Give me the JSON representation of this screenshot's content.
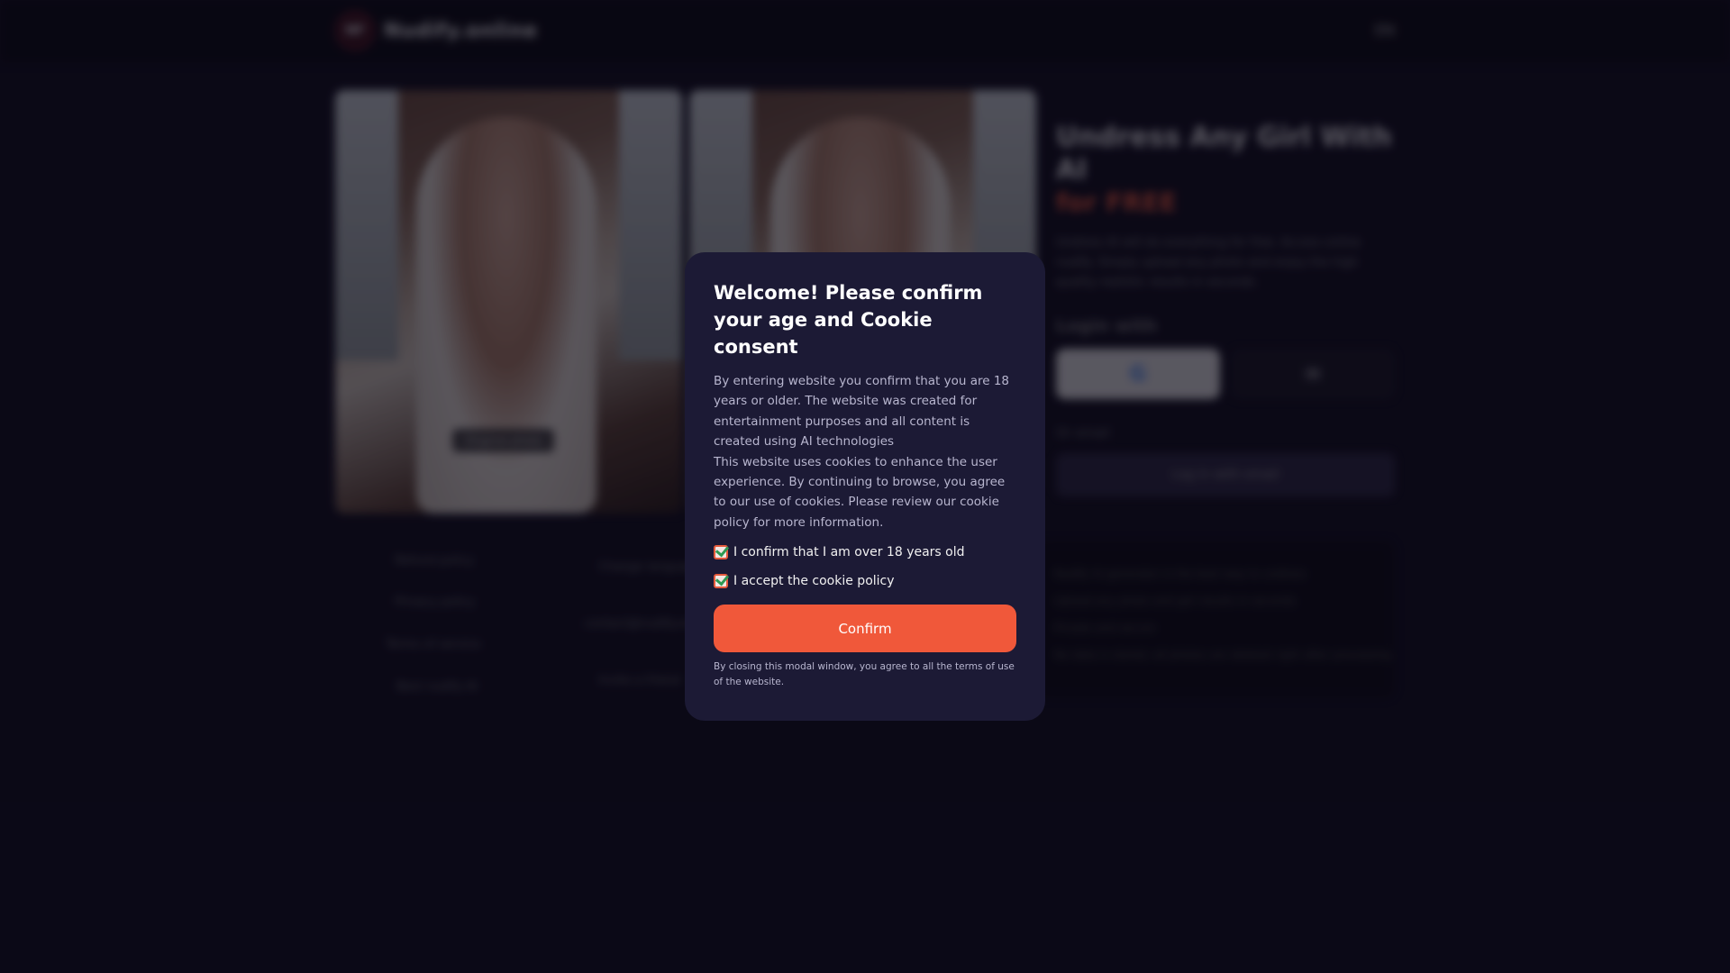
{
  "header": {
    "logo_mark": "NF",
    "logo_text": "Nudify.online",
    "language": "EN"
  },
  "hero": {
    "title": "Undress Any Girl With AI",
    "accent": "for FREE",
    "description": "Undress AI will do everything for free. Access online nudify. Simply upload any photo and enjoy the high quality realistic results in seconds.",
    "login_label": "Login with",
    "google_glyph": "G",
    "mail_glyph": "✉",
    "or_label": "Or email",
    "email_button": "Log in with email"
  },
  "gallery": {
    "photo_label": "Original photo"
  },
  "footer": {
    "links": [
      "Refund policy",
      "Privacy policy",
      "Terms of service",
      "Best nudify AI"
    ],
    "links2": [
      "Change language",
      "contact@nudify.online",
      "Invite a friend"
    ]
  },
  "info": {
    "lines": [
      "Nudify AI generator is the best way to undress",
      "Upload any photo and get results in seconds",
      "Private and secure",
      "No data is stored, all photos are deleted right after processing"
    ]
  },
  "modal": {
    "title": "Welcome! Please confirm your age and Cookie consent",
    "body_p1": "By entering website you confirm that you are 18 years or older. The website was created for entertainment purposes and all content is created using AI technologies",
    "body_p2": "This website uses cookies to enhance the user experience. By continuing to browse, you agree to our use of cookies. Please review our cookie policy for more information.",
    "age_check_label": "I confirm that I am over 18 years old",
    "cookie_check_label": "I accept the cookie policy",
    "confirm_label": "Confirm",
    "note": "By closing this modal window, you agree to all the terms of use of the website.",
    "age_checked": true,
    "cookie_checked": true
  },
  "colors": {
    "background": "#0d0b1a",
    "modal_bg": "#1c1a35",
    "accent": "#f0583a",
    "check_green": "#2e9a52"
  }
}
